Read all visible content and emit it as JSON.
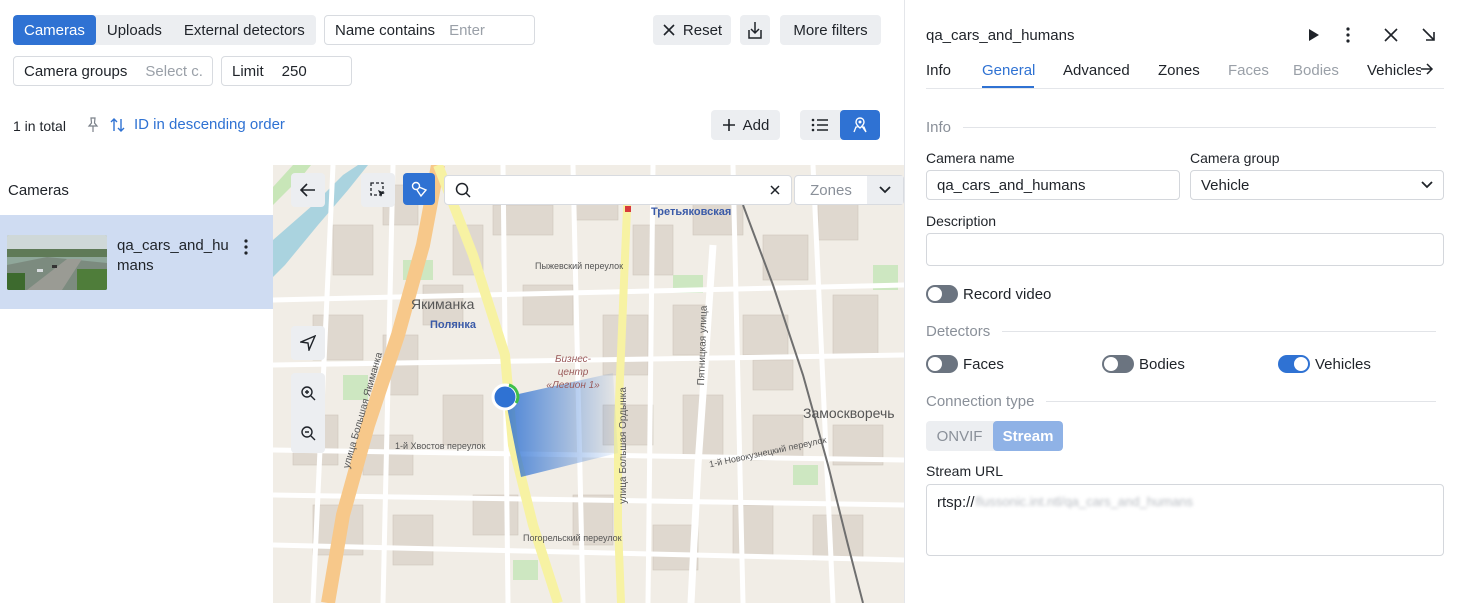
{
  "toolbar": {
    "source_tabs": [
      "Cameras",
      "Uploads",
      "External detectors"
    ],
    "name_filter": {
      "label": "Name contains",
      "placeholder": "Enter"
    },
    "reset_label": "Reset",
    "more_filters_label": "More filters",
    "camera_groups": {
      "label": "Camera groups",
      "placeholder": "Select c..."
    },
    "limit": {
      "label": "Limit",
      "value": "250"
    }
  },
  "list_bar": {
    "total": "1 in total",
    "sort_label": "ID in descending order",
    "add_label": "Add"
  },
  "sidebar": {
    "title": "Cameras",
    "camera_name": "qa_cars_and_humans"
  },
  "map": {
    "search_value": "",
    "zones_label": "Zones",
    "labels": {
      "tretyakovskaya": "Третьяковская",
      "yakimanka": "Якиманка",
      "polyanka": "Полянка",
      "zamoskvorechye": "Замоскворечь",
      "business_center": "Бизнес-центр «Легион 1»",
      "bolshaya_yakimanka": "улица Большая Якиманка",
      "bolshaya_ordynka": "улица Большая Ордынка",
      "pyatnitskaya": "Пятницкая улица",
      "khvostov": "1-й Хвостов переулок",
      "pyzhevsky": "Пыжевский переулок",
      "pogorelsky": "Погорельский переулок",
      "novokuznetsky": "1-й Новокузнецкий переулок"
    }
  },
  "panel": {
    "title": "qa_cars_and_humans",
    "tabs": [
      "Info",
      "General",
      "Advanced",
      "Zones",
      "Faces",
      "Bodies",
      "Vehicles"
    ],
    "active_tab": "General",
    "info_section": "Info",
    "camera_name_label": "Camera name",
    "camera_name_value": "qa_cars_and_humans",
    "camera_group_label": "Camera group",
    "camera_group_value": "Vehicle",
    "description_label": "Description",
    "description_value": "",
    "record_video_label": "Record video",
    "record_video_on": false,
    "detectors_section": "Detectors",
    "detectors": [
      {
        "label": "Faces",
        "on": false
      },
      {
        "label": "Bodies",
        "on": false
      },
      {
        "label": "Vehicles",
        "on": true
      }
    ],
    "connection_section": "Connection type",
    "connection_options": [
      "ONVIF",
      "Stream"
    ],
    "connection_selected": "Stream",
    "stream_url_label": "Stream URL",
    "stream_url_prefix": "rtsp://",
    "stream_url_rest": "flussonic.int.ntl/qa_cars_and_humans"
  },
  "colors": {
    "accent": "#2f72d3",
    "selected_row": "#cfdcf2",
    "button_bg": "#eceef1"
  }
}
